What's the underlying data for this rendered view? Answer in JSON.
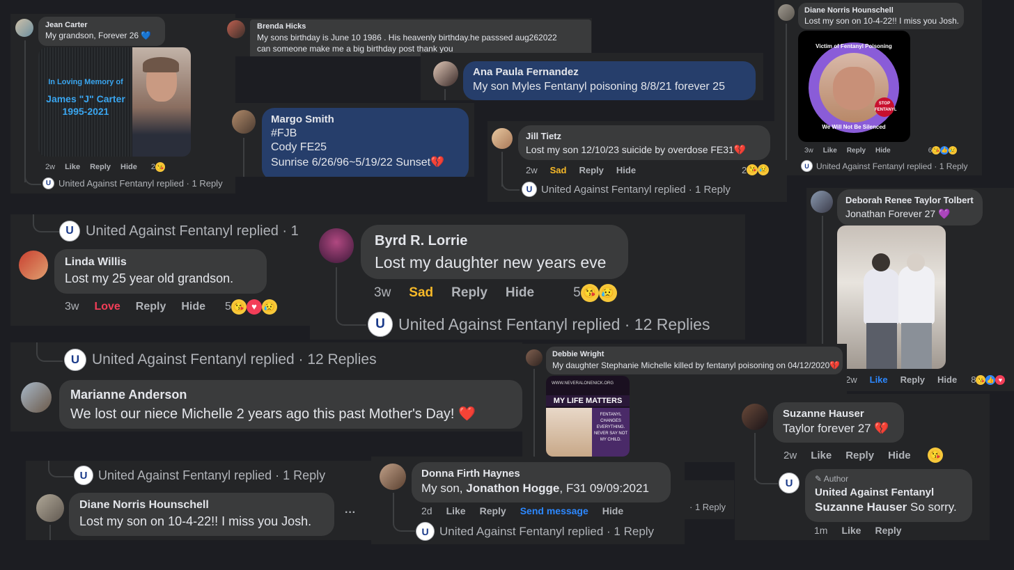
{
  "reply_labels": {
    "replied_1": "United Against Fentanyl replied · 1 Reply",
    "replied_12": "United Against Fentanyl replied · 12 Replies",
    "replied_cut": "United Against Fentanyl replied · 1",
    "reply_only": "· 1 Reply"
  },
  "actions": {
    "like": "Like",
    "reply": "Reply",
    "hide": "Hide",
    "sad": "Sad",
    "love": "Love",
    "send_message": "Send message"
  },
  "comments": {
    "jean": {
      "name": "Jean Carter",
      "text": "My grandson, Forever 26 💙",
      "time": "2w",
      "count": "2",
      "image": {
        "line1": "In Loving Memory of",
        "line2": "James \"J\" Carter",
        "line3": "1995-2021"
      }
    },
    "brenda": {
      "name": "Brenda Hicks",
      "line1": "My sons birthday is June 10 1986 . His heavenly birthday.he passsed aug262022",
      "line2": "can someone make me a big birthday post thank you"
    },
    "ana": {
      "name": "Ana Paula Fernandez",
      "text": "My son Myles Fentanyl poisoning 8/8/21 forever 25"
    },
    "margo": {
      "name": "Margo Smith",
      "line1": "#FJB",
      "line2": "Cody FE25",
      "line3": "Sunrise 6/26/96~5/19/22 Sunset💔"
    },
    "jill": {
      "name": "Jill Tietz",
      "text": "Lost my son 12/10/23 suicide by overdose FE31💔",
      "time": "2w",
      "count": "2"
    },
    "diane_top": {
      "name": "Diane Norris Hounschell",
      "text": "Lost my son on 10-4-22!! I miss you Josh.",
      "time": "3w",
      "count": "6",
      "image": {
        "ring_top": "Victim of Fentanyl Poisoning",
        "ring_bottom": "We Will Not Be Silenced",
        "stop": "STOP FENTANYL"
      }
    },
    "deborah": {
      "name": "Deborah Renee Taylor Tolbert",
      "text": "Jonathan Forever 27 💜",
      "time": "2w",
      "count": "8"
    },
    "linda": {
      "name": "Linda Willis",
      "text": "Lost my 25 year old grandson.",
      "time": "3w",
      "count": "5"
    },
    "byrd": {
      "name": "Byrd R. Lorrie",
      "text": "Lost my daughter new years eve",
      "time": "3w",
      "count": "5"
    },
    "marianne": {
      "name": "Marianne Anderson",
      "text": "We lost our niece Michelle 2 years ago this past Mother's Day! ❤️"
    },
    "debbie": {
      "name": "Debbie Wright",
      "text": "My daughter Stephanie Michelle killed by fentanyl poisoning on 04/12/2020💔",
      "image": {
        "url": "WWW.NEVERALONENICK.ORG",
        "title": "MY LIFE MATTERS",
        "quote": "FENTANYL CHANGES EVERYTHING. NEVER SAY NOT MY CHILD."
      }
    },
    "suzanne": {
      "name": "Suzanne Hauser",
      "text": "Taylor forever 27 💔",
      "time": "2w"
    },
    "author_reply": {
      "badge": "Author",
      "name": "United Against Fentanyl",
      "mention": "Suzanne Hauser",
      "text": "So sorry.",
      "time": "1m"
    },
    "diane_bottom": {
      "name": "Diane Norris Hounschell",
      "text": "Lost my son on 10-4-22!! I miss you Josh.",
      "more": "···"
    },
    "donna": {
      "name": "Donna Firth Haynes",
      "text_prefix": "My son,",
      "text_bold": "Jonathon Hogge",
      "text_suffix": ", F31 09/09:2021",
      "time": "2d"
    }
  },
  "colors": {
    "background": "#1c1d22",
    "panel": "#242527",
    "bubble": "#3a3b3c",
    "bubble_blue": "#263e6b",
    "sad": "#f7b928",
    "love": "#f33e58",
    "link": "#2d88ff"
  }
}
